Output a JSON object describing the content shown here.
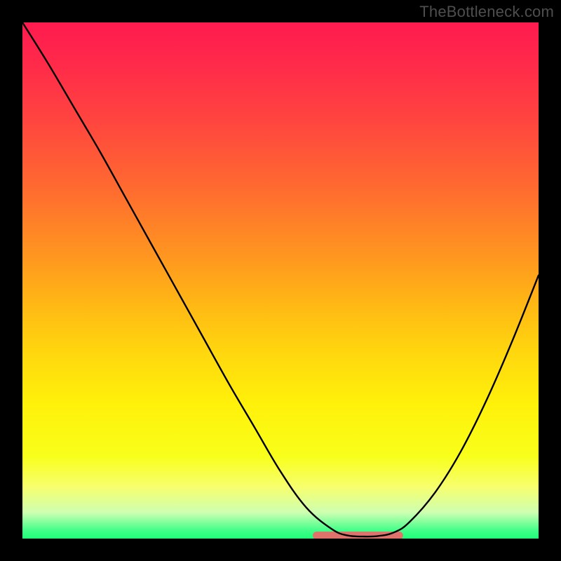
{
  "watermark": "TheBottleneck.com",
  "colors": {
    "gradient_top": "#ff1a4f",
    "gradient_mid": "#ffd70e",
    "gradient_bottom": "#1fff7a",
    "curve": "#000000",
    "accent": "#e0726c",
    "frame": "#000000"
  },
  "chart_data": {
    "type": "line",
    "title": "",
    "xlabel": "",
    "ylabel": "",
    "xlim": [
      0,
      100
    ],
    "ylim": [
      0,
      100
    ],
    "grid": false,
    "series": [
      {
        "name": "bottleneck-curve",
        "x": [
          0,
          5,
          10,
          15,
          20,
          25,
          30,
          35,
          40,
          45,
          50,
          55,
          60,
          63,
          66,
          69,
          72,
          75,
          80,
          85,
          90,
          95,
          100
        ],
        "y": [
          100,
          92,
          83.5,
          75,
          66,
          57,
          48,
          39,
          30,
          21.5,
          13,
          6,
          1.8,
          0.6,
          0.4,
          0.5,
          1.2,
          3.2,
          9,
          17,
          27,
          38.5,
          51
        ]
      }
    ],
    "annotations": [
      {
        "name": "accent-floor",
        "x_range": [
          57,
          73
        ],
        "y": 0.6
      }
    ]
  }
}
